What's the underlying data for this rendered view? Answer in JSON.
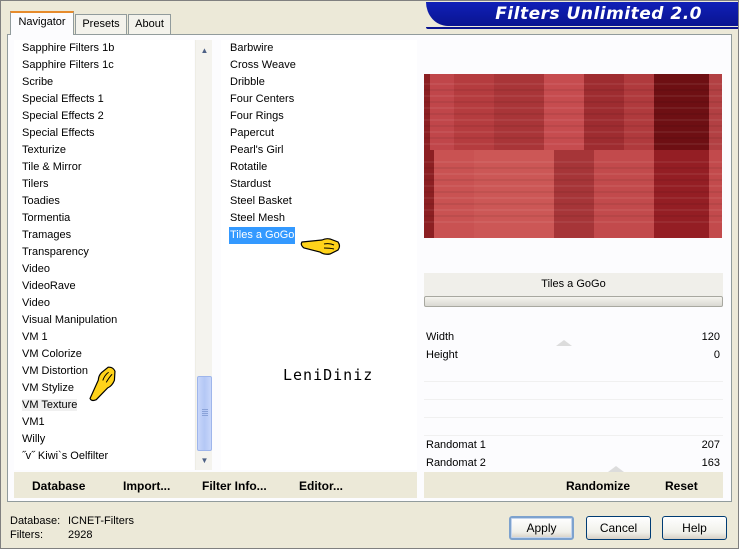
{
  "tabs": [
    "Navigator",
    "Presets",
    "About"
  ],
  "title": "Filters Unlimited 2.0",
  "categories": [
    "Sapphire Filters 1b",
    "Sapphire Filters 1c",
    "Scribe",
    "Special Effects 1",
    "Special Effects 2",
    "Special Effects",
    "Texturize",
    "Tile & Mirror",
    "Tilers",
    "Toadies",
    "Tormentia",
    "Tramages",
    "Transparency",
    "Video",
    "VideoRave",
    "Video",
    "Visual Manipulation",
    "VM 1",
    "VM Colorize",
    "VM Distortion",
    "VM Stylize",
    "VM Texture",
    "VM1",
    "Willy",
    "˝v˝ Kiwi`s Oelfilter"
  ],
  "selected_category": "VM Texture",
  "filters": [
    "Barbwire",
    "Cross Weave",
    "Dribble",
    "Four Centers",
    "Four Rings",
    "Papercut",
    "Pearl's Girl",
    "Rotatile",
    "Stardust",
    "Steel Basket",
    "Steel Mesh",
    "Tiles a GoGo"
  ],
  "selected_filter": "Tiles a GoGo",
  "logo_text": "LeniDiniz",
  "filter_name": "Tiles a GoGo",
  "params": [
    {
      "label": "Width",
      "value": "120"
    },
    {
      "label": "Height",
      "value": "0"
    },
    {
      "label": "Randomat 1",
      "value": "207"
    },
    {
      "label": "Randomat 2",
      "value": "163"
    }
  ],
  "bottom_left_buttons": {
    "database": "Database",
    "import": "Import...",
    "filter_info": "Filter Info...",
    "editor": "Editor..."
  },
  "bottom_right_buttons": {
    "randomize": "Randomize",
    "reset": "Reset"
  },
  "status": {
    "database_label": "Database:",
    "database_value": "ICNET-Filters",
    "filters_label": "Filters:",
    "filters_value": "2928"
  },
  "dialog_buttons": {
    "apply": "Apply",
    "cancel": "Cancel",
    "help": "Help"
  },
  "colors": {
    "selection": "#3399ff",
    "banner": "#1020b8",
    "preview_base": "#c0464a"
  }
}
